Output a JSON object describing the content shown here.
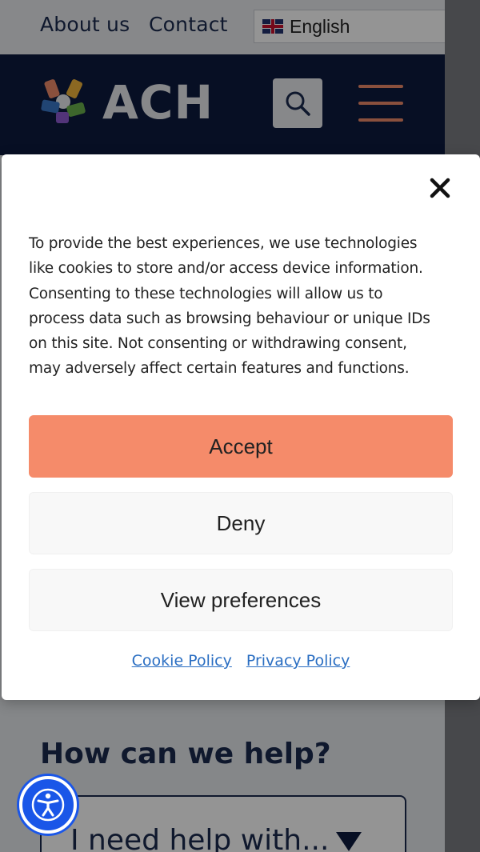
{
  "topbar": {
    "links": [
      "About us",
      "Contact"
    ],
    "language": {
      "selected": "English",
      "flag_icon": "uk-flag-icon"
    }
  },
  "header": {
    "logo_text": "ACH",
    "search_icon": "search-icon",
    "menu_icon": "hamburger-menu-icon",
    "colors": {
      "navy": "#0d1b3e",
      "accent": "#ee8a6a"
    }
  },
  "main": {
    "help_title": "How can we help?",
    "help_select_value": "I need help with..."
  },
  "cookie_dialog": {
    "close_icon": "close-icon",
    "text_lines": [
      "To provide the best experiences, we use technologies",
      "like cookies to store and/or access device information.",
      "Consenting to these technologies will allow us to",
      "process data such as browsing behaviour or unique IDs",
      "on this site. Not consenting or withdrawing consent,",
      "may adversely affect certain features and functions."
    ],
    "accept_label": "Accept",
    "deny_label": "Deny",
    "preferences_label": "View preferences",
    "links": {
      "cookie_policy": "Cookie Policy",
      "privacy_policy": "Privacy Policy"
    },
    "colors": {
      "accept": "#f58b6a",
      "link": "#2a6ec2"
    }
  },
  "accessibility": {
    "icon": "accessibility-icon",
    "color": "#1a56e8"
  }
}
